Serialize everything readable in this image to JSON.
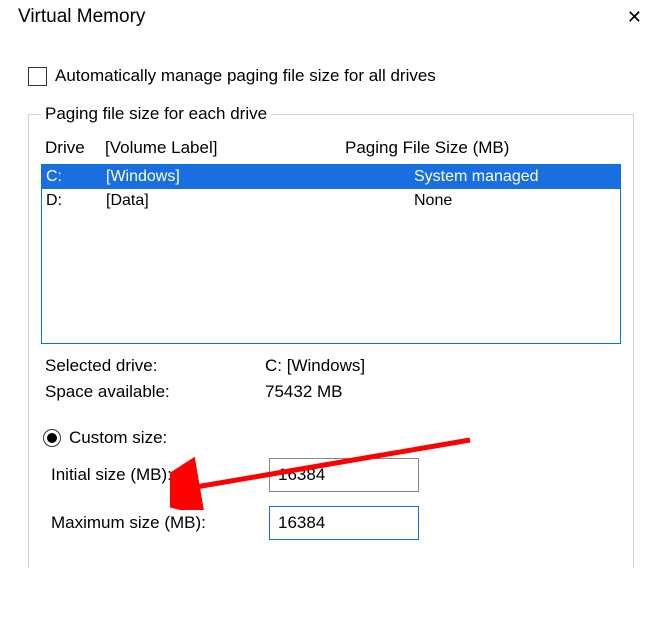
{
  "window": {
    "title": "Virtual Memory"
  },
  "auto_manage": {
    "label": "Automatically manage paging file size for all drives",
    "checked": false
  },
  "group": {
    "legend": "Paging file size for each drive",
    "header": {
      "drive": "Drive",
      "volume": "[Volume Label]",
      "pfs": "Paging File Size (MB)"
    },
    "rows": [
      {
        "drive": "C:",
        "volume": "[Windows]",
        "pfs": "System managed",
        "selected": true
      },
      {
        "drive": "D:",
        "volume": "[Data]",
        "pfs": "None",
        "selected": false
      }
    ],
    "selected_drive": {
      "label": "Selected drive:",
      "value": "C:  [Windows]"
    },
    "space_available": {
      "label": "Space available:",
      "value": "75432 MB"
    },
    "custom_size": {
      "label": "Custom size:",
      "checked": true,
      "initial": {
        "label": "Initial size (MB):",
        "value": "16384"
      },
      "maximum": {
        "label": "Maximum size (MB):",
        "value": "16384"
      }
    }
  }
}
